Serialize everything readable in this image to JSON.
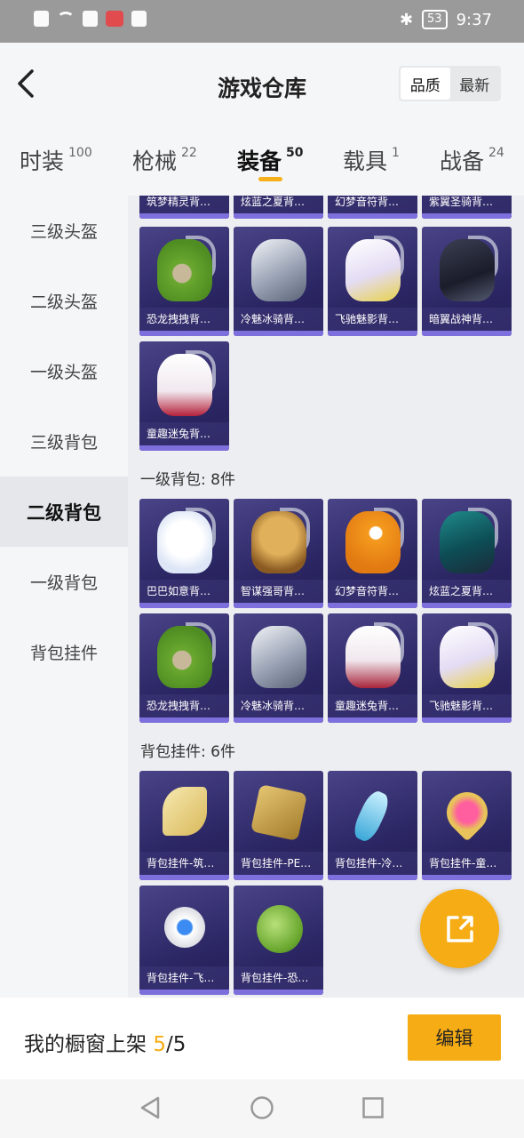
{
  "status": {
    "time": "9:37",
    "battery": "53"
  },
  "header": {
    "title": "游戏仓库",
    "sort_quality": "品质",
    "sort_latest": "最新"
  },
  "tabs": [
    {
      "label": "时装",
      "count": "100"
    },
    {
      "label": "枪械",
      "count": "22"
    },
    {
      "label": "装备",
      "count": "50"
    },
    {
      "label": "载具",
      "count": "1"
    },
    {
      "label": "战备",
      "count": "24"
    }
  ],
  "sidebar": [
    "三级头盔",
    "二级头盔",
    "一级头盔",
    "三级背包",
    "二级背包",
    "一级背包",
    "背包挂件"
  ],
  "top_partial_row": [
    "筑梦精灵背…",
    "炫蓝之夏背…",
    "幻梦音符背…",
    "紫翼圣骑背…"
  ],
  "group_a": [
    "恐龙拽拽背…",
    "冷魅冰骑背…",
    "飞驰魅影背…",
    "暗翼战神背…",
    "童趣迷兔背…"
  ],
  "section_b": "一级背包: 8件",
  "group_b": [
    "巴巴如意背…",
    "智谋强哥背…",
    "幻梦音符背…",
    "炫蓝之夏背…",
    "恐龙拽拽背…",
    "冷魅冰骑背…",
    "童趣迷兔背…",
    "飞驰魅影背…"
  ],
  "section_c": "背包挂件: 6件",
  "group_c": [
    "背包挂件-筑…",
    "背包挂件-PE…",
    "背包挂件-冷…",
    "背包挂件-童…",
    "背包挂件-飞…",
    "背包挂件-恐…"
  ],
  "bottom": {
    "text": "我的橱窗上架 ",
    "current": "5",
    "total": "/5",
    "edit": "编辑"
  },
  "colors": {
    "accent": "#f6ac14",
    "card_bg": "#2c2765"
  }
}
